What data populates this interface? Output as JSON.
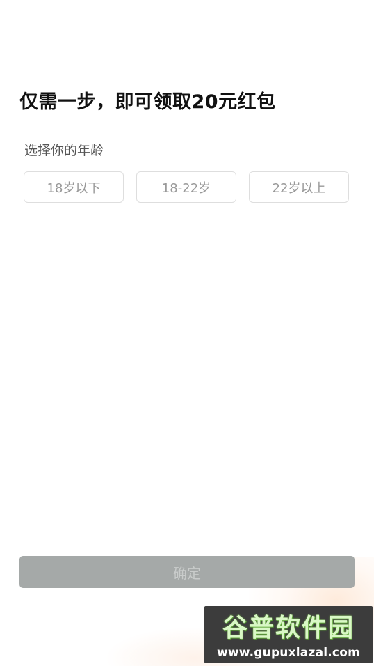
{
  "header": {
    "title": "仅需一步，即可领取20元红包"
  },
  "age_section": {
    "label": "选择你的年龄",
    "options": [
      {
        "label": "18岁以下",
        "selected": false
      },
      {
        "label": "18-22岁",
        "selected": false
      },
      {
        "label": "22岁以上",
        "selected": false
      }
    ]
  },
  "footer": {
    "confirm_label": "确定",
    "confirm_enabled": false
  },
  "watermark": {
    "name": "谷普软件园",
    "url": "www.gupuxlazal.com"
  },
  "colors": {
    "title": "#111111",
    "option_border": "#dedede",
    "option_text": "#999999",
    "confirm_bg_disabled": "#a5a9a8",
    "confirm_text_disabled": "#c9cccb"
  }
}
